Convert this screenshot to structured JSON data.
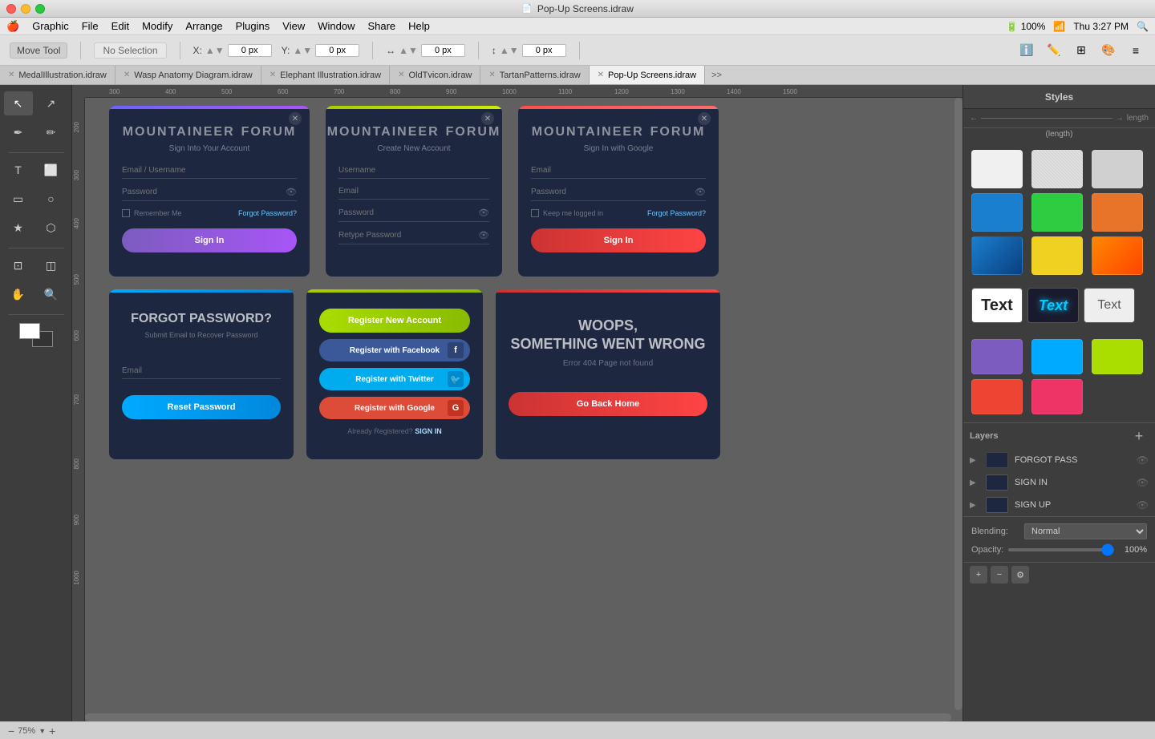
{
  "app": {
    "title": "Pop-Up Screens.idraw",
    "app_name": "Graphic"
  },
  "menubar": {
    "apple": "🍎",
    "items": [
      "Graphic",
      "File",
      "Edit",
      "Modify",
      "Arrange",
      "Plugins",
      "View",
      "Window",
      "Share",
      "Help"
    ]
  },
  "toolbar": {
    "tool_label": "Move Tool",
    "selection": "No Selection",
    "x_label": "X:",
    "x_value": "0 px",
    "y_label": "Y:",
    "y_value": "0 px",
    "w_value": "0 px",
    "h_value": "0 px"
  },
  "tabs": [
    {
      "label": "MedalIllustration.idraw",
      "active": false
    },
    {
      "label": "Wasp Anatomy Diagram.idraw",
      "active": false
    },
    {
      "label": "Elephant Illustration.idraw",
      "active": false
    },
    {
      "label": "OldTvicon.idraw",
      "active": false
    },
    {
      "label": "TartanPatterns.idraw",
      "active": false
    },
    {
      "label": "Pop-Up Screens.idraw",
      "active": true
    }
  ],
  "styles_panel": {
    "title": "Styles"
  },
  "ruler": {
    "marks": [
      "300",
      "400",
      "500",
      "600",
      "700",
      "800",
      "900",
      "1000",
      "1100",
      "1200",
      "1300",
      "1400",
      "1500"
    ]
  },
  "screens": {
    "signin": {
      "logo_part1": "MOUNTAINEER",
      "logo_part2": "FORUM",
      "subtitle": "Sign Into Your Account",
      "email_placeholder": "Email / Username",
      "password_placeholder": "Password",
      "remember_label": "Remember Me",
      "forgot_label": "Forgot Password?",
      "btn_label": "Sign In"
    },
    "signin_google": {
      "logo_part1": "MOUNTAINEER",
      "logo_part2": "FORUM",
      "subtitle": "Sign In with Google",
      "email_placeholder": "Email",
      "password_placeholder": "Password",
      "remember_label": "Keep me logged in",
      "forgot_label": "Forgot Password?",
      "btn_label": "Sign In"
    },
    "signup": {
      "logo_part1": "MOUNTAINEER",
      "logo_part2": "FORUM",
      "subtitle": "Create New Account",
      "username_placeholder": "Username",
      "email_placeholder": "Email",
      "password_placeholder": "Password",
      "retype_placeholder": "Retype Password"
    },
    "forgot": {
      "title": "FORGOT PASSWORD?",
      "subtitle": "Submit Email to Recover Password",
      "email_placeholder": "Email",
      "btn_label": "Reset Password"
    },
    "register": {
      "btn_register": "Register New Account",
      "btn_facebook": "Register with Facebook",
      "btn_twitter": "Register with Twitter",
      "btn_google": "Register with Google",
      "already_text": "Already Registered?",
      "signin_link": "SIGN IN"
    },
    "error": {
      "title_line1": "WOOPS,",
      "title_line2": "SOMETHING WENT WRONG",
      "subtitle": "Error 404 Page not found",
      "btn_label": "Go Back Home"
    }
  },
  "layers": {
    "title": "Layers",
    "items": [
      {
        "name": "FORGOT PASS",
        "visible": true
      },
      {
        "name": "SIGN IN",
        "visible": true
      },
      {
        "name": "SIGN UP",
        "visible": true
      }
    ]
  },
  "blending": {
    "label": "Blending:",
    "value": "Normal",
    "opacity_label": "Opacity:",
    "opacity_value": "100%"
  },
  "zoom": {
    "value": "75%"
  }
}
